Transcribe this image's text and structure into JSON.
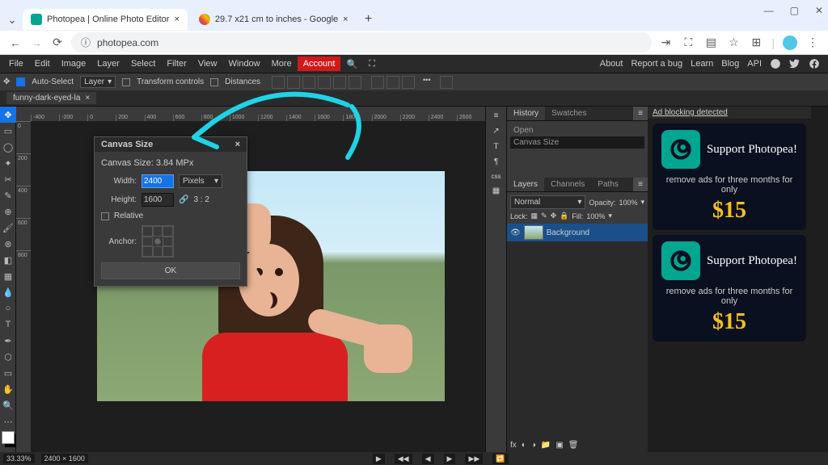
{
  "browser": {
    "tabs": [
      {
        "title": "Photopea | Online Photo Editor"
      },
      {
        "title": "29.7 x21 cm to inches - Google"
      }
    ],
    "url": "photopea.com",
    "window_controls": [
      "—",
      "▢",
      "✕"
    ]
  },
  "menu": {
    "items": [
      "File",
      "Edit",
      "Image",
      "Layer",
      "Select",
      "Filter",
      "View",
      "Window",
      "More"
    ],
    "account": "Account",
    "right": [
      "About",
      "Report a bug",
      "Learn",
      "Blog",
      "API"
    ]
  },
  "options": {
    "auto_select": "Auto-Select",
    "layer": "Layer",
    "transform": "Transform controls",
    "distances": "Distances"
  },
  "file_tab": "funny-dark-eyed-la",
  "ruler_h": [
    "-400",
    "-200",
    "0",
    "200",
    "400",
    "600",
    "800",
    "1000",
    "1200",
    "1400",
    "1600",
    "1800",
    "2000",
    "2200",
    "2400",
    "2600"
  ],
  "ruler_v": [
    "0",
    "200",
    "400",
    "600",
    "800"
  ],
  "dialog": {
    "title": "Canvas Size",
    "size_label": "Canvas Size: 3.84 MPx",
    "width_label": "Width:",
    "width_value": "2400",
    "units": "Pixels",
    "height_label": "Height:",
    "height_value": "1600",
    "ratio": "3 : 2",
    "relative": "Relative",
    "anchor_label": "Anchor:",
    "ok": "OK"
  },
  "history": {
    "tab1": "History",
    "tab2": "Swatches",
    "items": [
      "Open",
      "Canvas Size"
    ]
  },
  "layers": {
    "tab1": "Layers",
    "tab2": "Channels",
    "tab3": "Paths",
    "blend": "Normal",
    "opacity_label": "Opacity:",
    "opacity": "100%",
    "lock_label": "Lock:",
    "fill_label": "Fill:",
    "fill": "100%",
    "layer_name": "Background"
  },
  "mid_labels": {
    "css": "css"
  },
  "ads": {
    "header": "Ad blocking detected",
    "title": "Support Photopea!",
    "text": "remove ads for three months for only",
    "price": "$15"
  },
  "status": {
    "zoom": "33.33%",
    "dims": "2400 × 1600"
  }
}
